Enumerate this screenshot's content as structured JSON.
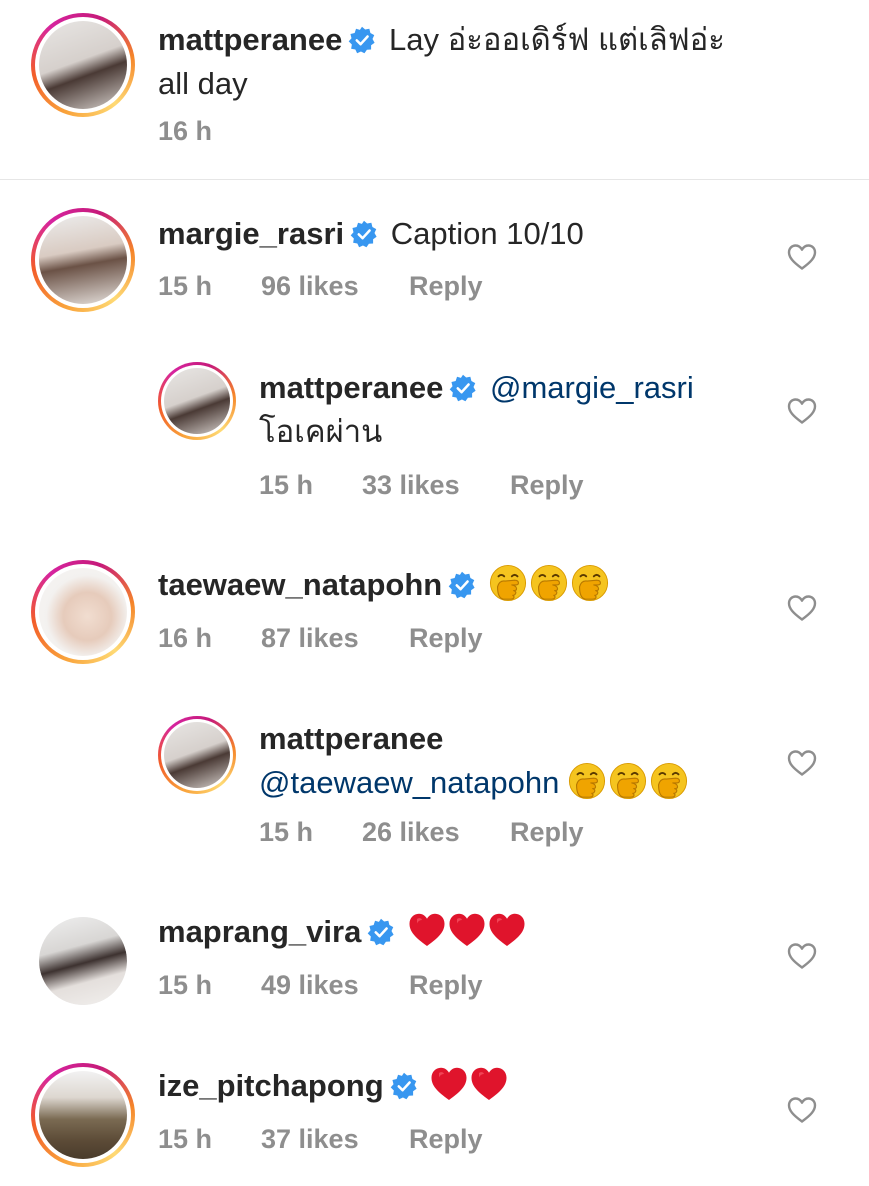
{
  "colors": {
    "verified": "#3897f0",
    "mention": "#00376b",
    "meta": "#8e8e8e",
    "heart_red": "#e0142c"
  },
  "comments": [
    {
      "username": "mattperanee",
      "verified": true,
      "text": "Lay อ่ะออเดิร์ฟ แต่เลิฟอ่ะ",
      "text_line2": "all day",
      "time": "16 h"
    },
    {
      "username": "margie_rasri",
      "verified": true,
      "text": "Caption 10/10",
      "time": "15 h",
      "likes": "96 likes",
      "reply": "Reply"
    },
    {
      "username": "mattperanee",
      "verified": true,
      "mention": "@margie_rasri",
      "text_line2": "โอเคผ่าน",
      "time": "15 h",
      "likes": "33 likes",
      "reply": "Reply"
    },
    {
      "username": "taewaew_natapohn",
      "verified": true,
      "emoji": "hand-over-mouth x3",
      "time": "16 h",
      "likes": "87 likes",
      "reply": "Reply"
    },
    {
      "username": "mattperanee",
      "verified": false,
      "mention": "@taewaew_natapohn",
      "emoji": "hand-over-mouth x3",
      "time": "15 h",
      "likes": "26 likes",
      "reply": "Reply"
    },
    {
      "username": "maprang_vira",
      "verified": true,
      "emoji": "red-heart x3",
      "time": "15 h",
      "likes": "49 likes",
      "reply": "Reply"
    },
    {
      "username": "ize_pitchapong",
      "verified": true,
      "emoji": "red-heart x2",
      "time": "15 h",
      "likes": "37 likes",
      "reply": "Reply"
    }
  ]
}
